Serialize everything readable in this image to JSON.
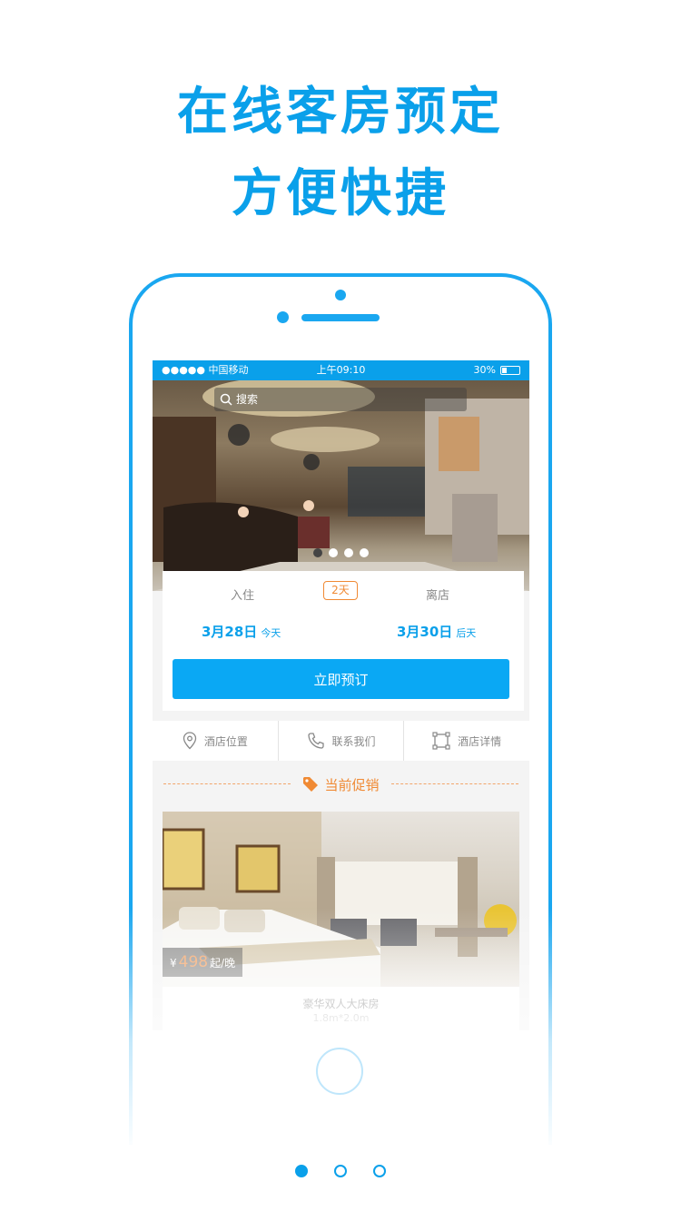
{
  "headline": {
    "line1": "在线客房预定",
    "line2": "方便快捷"
  },
  "colors": {
    "brand": "#0aa0ea",
    "accent": "#f08a34"
  },
  "status_bar": {
    "carrier": "●●●●● 中国移动",
    "time": "上午09:10",
    "battery": "30%",
    "battery_level": 0.3
  },
  "search": {
    "placeholder": "搜索",
    "icon": "search-icon"
  },
  "carousel": {
    "count": 4,
    "active": 0
  },
  "booking": {
    "checkin_label": "入住",
    "nights": "2天",
    "checkout_label": "离店",
    "checkin_date": "3月28日",
    "checkin_day": "今天",
    "checkout_date": "3月30日",
    "checkout_day": "后天",
    "book_button": "立即预订"
  },
  "actions": [
    {
      "label": "酒店位置",
      "icon": "location-pin-icon"
    },
    {
      "label": "联系我们",
      "icon": "phone-icon"
    },
    {
      "label": "酒店详情",
      "icon": "details-frame-icon"
    }
  ],
  "promotion": {
    "title": "当前促销",
    "icon": "tag-icon"
  },
  "room": {
    "currency": "¥",
    "price": "498",
    "unit": "起/晚",
    "name": "豪华双人大床房",
    "size": "1.8m*2.0m"
  },
  "pager": {
    "count": 3,
    "active": 0
  }
}
